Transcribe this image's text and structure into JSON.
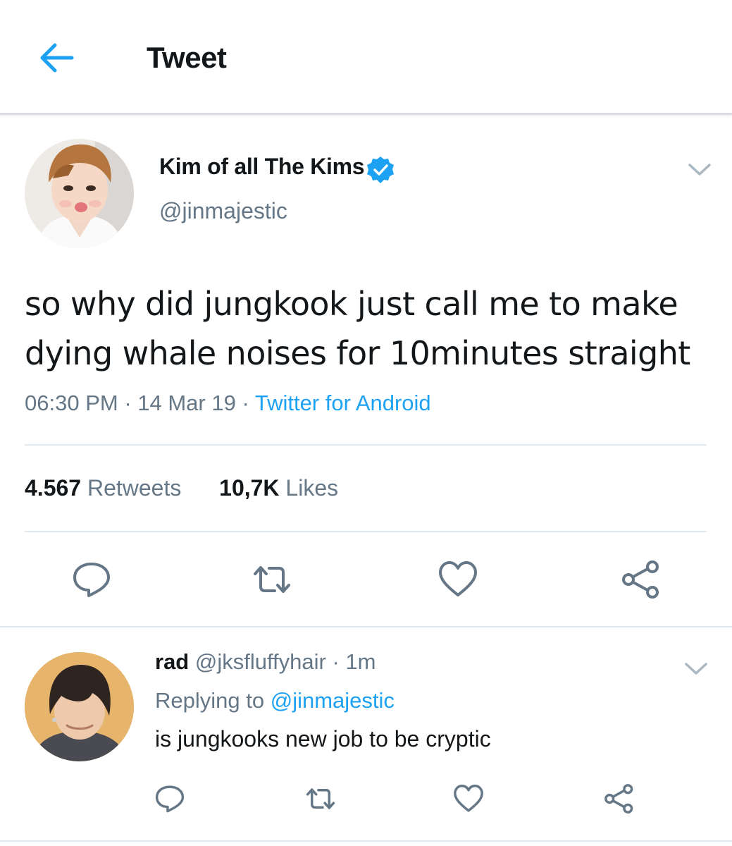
{
  "header": {
    "title": "Tweet",
    "back_icon": "arrow-left-icon"
  },
  "colors": {
    "accent": "#1da1f2",
    "text_primary": "#14171a",
    "text_secondary": "#657786",
    "divider": "#e1e8ed"
  },
  "tweet": {
    "display_name": "Kim of all The Kims",
    "verified": true,
    "handle": "@jinmajestic",
    "text": "so why did jungkook just call me to make dying whale noises for 10minutes straight",
    "time": "06:30 PM",
    "separator_1": " · ",
    "date": "14 Mar 19",
    "separator_2": " · ",
    "source": "Twitter for Android",
    "retweets_count": "4.567",
    "retweets_label": "Retweets",
    "likes_count": "10,7K",
    "likes_label": "Likes",
    "actions": [
      "reply-icon",
      "retweet-icon",
      "like-icon",
      "share-icon"
    ]
  },
  "reply": {
    "display_name": "rad",
    "handle": "@jksfluffyhair",
    "separator": " · ",
    "time": "1m",
    "replying_prefix": "Replying to ",
    "replying_to": "@jinmajestic",
    "text": "is jungkooks new job to be cryptic",
    "actions": [
      "reply-icon",
      "retweet-icon",
      "like-icon",
      "share-icon"
    ]
  }
}
